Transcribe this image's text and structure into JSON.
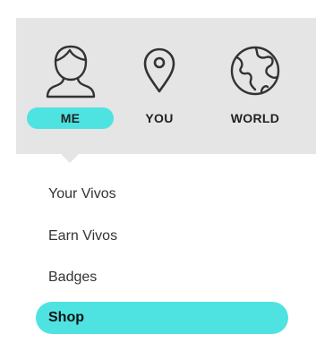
{
  "colors": {
    "accent": "#4ee3e1",
    "header_bg": "#e5e5e5",
    "icon_stroke": "#333333"
  },
  "tabs": [
    {
      "key": "me",
      "label": "ME",
      "icon": "person-icon",
      "active": true
    },
    {
      "key": "you",
      "label": "YOU",
      "icon": "map-pin-icon",
      "active": false
    },
    {
      "key": "world",
      "label": "WORLD",
      "icon": "globe-icon",
      "active": false
    }
  ],
  "menu": {
    "items": [
      {
        "label": "Your Vivos",
        "active": false
      },
      {
        "label": "Earn Vivos",
        "active": false
      },
      {
        "label": "Badges",
        "active": false
      },
      {
        "label": "Shop",
        "active": true
      }
    ]
  }
}
